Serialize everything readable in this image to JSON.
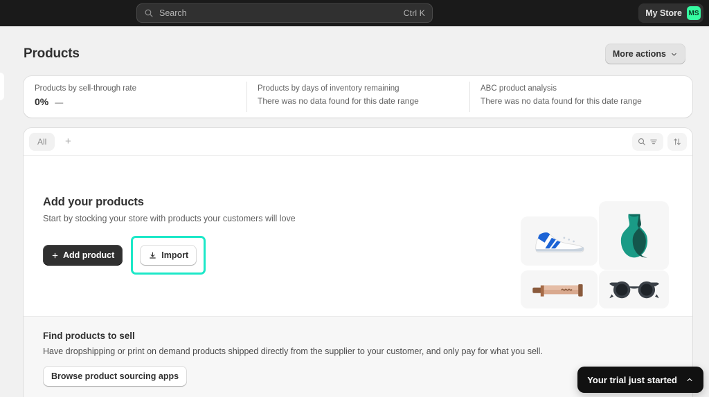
{
  "topbar": {
    "search": {
      "placeholder": "Search",
      "shortcut": "Ctrl K",
      "icon": "search-icon"
    },
    "notifications_icon": "bell-icon",
    "store_name": "My Store",
    "store_initials": "MS",
    "avatar_color": "#36fba1",
    "background": "#1a1a1a"
  },
  "header": {
    "title": "Products",
    "more_actions_label": "More actions",
    "more_actions_icon": "chevron-down-icon"
  },
  "metrics": [
    {
      "label": "Products by sell-through rate",
      "value": "0%",
      "delta": "—",
      "empty": ""
    },
    {
      "label": "Products by days of inventory remaining",
      "value": "",
      "delta": "",
      "empty": "There was no data found for this date range"
    },
    {
      "label": "ABC product analysis",
      "value": "",
      "delta": "",
      "empty": "There was no data found for this date range"
    }
  ],
  "tabbar": {
    "tabs": [
      {
        "label": "All",
        "selected": true
      }
    ],
    "add_tab_label": "+",
    "search_filter_icon": "search-filter-icon",
    "sort_icon": "sort-arrows-icon"
  },
  "empty_state": {
    "title": "Add your products",
    "subtitle": "Start by stocking your store with products your customers will love",
    "add_product_label": "Add product",
    "add_product_icon": "plus-icon",
    "import_label": "Import",
    "import_icon": "download-icon",
    "highlight_color": "#1ce8c8",
    "illustrations": [
      {
        "name": "sneaker-illustration"
      },
      {
        "name": "vase-illustration"
      },
      {
        "name": "paint-tube-illustration"
      },
      {
        "name": "sunglasses-illustration"
      }
    ]
  },
  "find_products": {
    "title": "Find products to sell",
    "description": "Have dropshipping or print on demand products shipped directly from the supplier to your customer, and only pay for what you sell.",
    "button_label": "Browse product sourcing apps"
  },
  "trial_banner": {
    "text": "Your trial just started",
    "icon": "chevron-up-icon"
  }
}
